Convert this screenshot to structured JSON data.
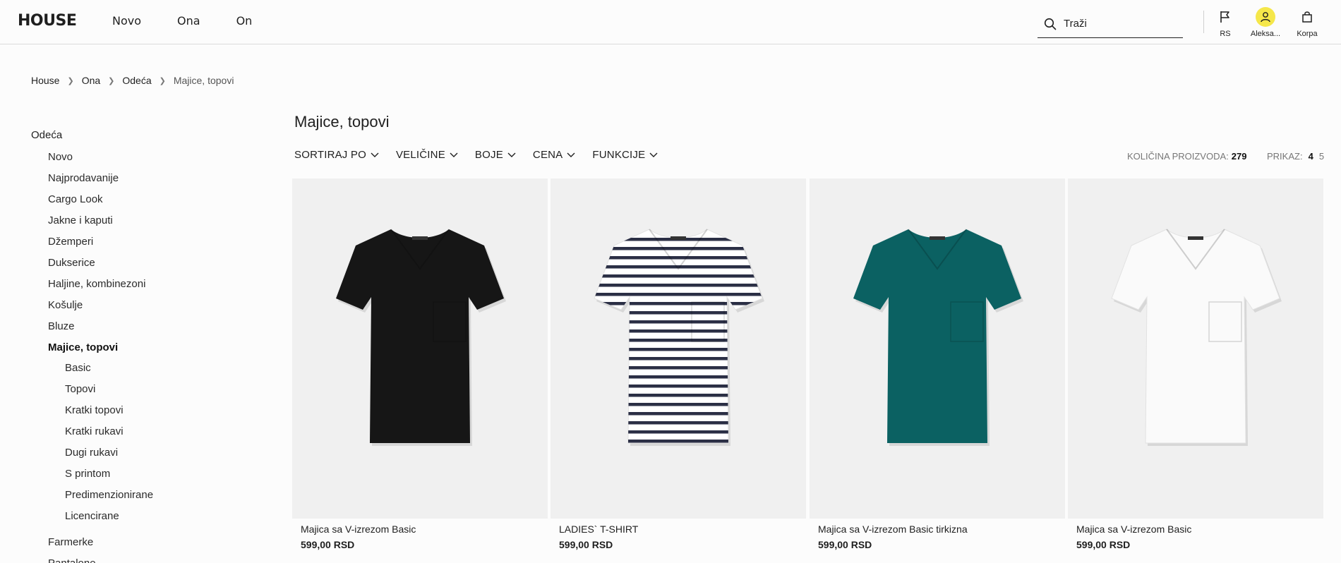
{
  "brand": {
    "logo": "HOUSE"
  },
  "nav": {
    "items": [
      "Novo",
      "Ona",
      "On"
    ]
  },
  "search": {
    "placeholder": "Traži",
    "icon": "search-icon"
  },
  "header_actions": {
    "country": {
      "label": "RS",
      "icon": "flag-icon"
    },
    "account": {
      "label": "Aleksa...",
      "icon": "user-icon",
      "avatar_color": "#f5e74a"
    },
    "cart": {
      "label": "Korpa",
      "icon": "bag-icon"
    }
  },
  "breadcrumb": {
    "items": [
      "House",
      "Ona",
      "Odeća"
    ],
    "current": "Majice, topovi"
  },
  "sidebar": {
    "title": "Odeća",
    "items_top": [
      "Novo",
      "Najprodavanije",
      "Cargo Look",
      "Jakne i kaputi",
      "Džemperi",
      "Dukserice",
      "Haljine, kombinezoni",
      "Košulje",
      "Bluze"
    ],
    "active": "Majice, topovi",
    "sub_items": [
      "Basic",
      "Topovi",
      "Kratki topovi",
      "Kratki rukavi",
      "Dugi rukavi",
      "S printom",
      "Predimenzionirane",
      "Licencirane"
    ],
    "items_bottom": [
      "Farmerke",
      "Pantalone"
    ]
  },
  "main": {
    "title": "Majice, topovi",
    "filters": [
      "SORTIRAJ PO",
      "VELIČINE",
      "BOJE",
      "CENA",
      "FUNKCIJE"
    ],
    "count_label": "KOLIČINA PROIZVODA:",
    "count_value": "279",
    "view_label": "PRIKAZ:",
    "view_options": [
      "4",
      "5"
    ],
    "view_selected": "4"
  },
  "products": [
    {
      "name": "Majica sa V-izrezom Basic",
      "price": "599,00 RSD",
      "color": "#161616",
      "pattern": "solid"
    },
    {
      "name": "LADIES` T-SHIRT",
      "price": "599,00 RSD",
      "color": "#ffffff",
      "pattern": "stripes",
      "stripe_color": "#2b2f45"
    },
    {
      "name": "Majica sa V-izrezom Basic tirkizna",
      "price": "599,00 RSD",
      "color": "#0b6162",
      "pattern": "solid"
    },
    {
      "name": "Majica sa V-izrezom Basic",
      "price": "599,00 RSD",
      "color": "#fafafa",
      "pattern": "solid"
    }
  ]
}
